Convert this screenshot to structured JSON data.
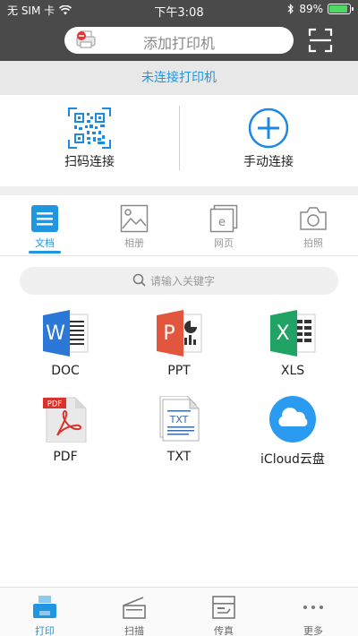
{
  "status_bar": {
    "carrier": "无 SIM 卡",
    "time": "下午3:08",
    "battery_percent": "89%",
    "battery_level": 0.89
  },
  "top_bar": {
    "add_printer_label": "添加打印机",
    "icons": {
      "printer": "printer-remove-icon",
      "scan": "scan-corners-icon"
    }
  },
  "connection": {
    "status_text": "未连接打印机",
    "qr_label": "扫码连接",
    "manual_label": "手动连接"
  },
  "tabs": [
    {
      "label": "文档",
      "icon": "document-icon",
      "active": true
    },
    {
      "label": "相册",
      "icon": "photo-icon",
      "active": false
    },
    {
      "label": "网页",
      "icon": "webpage-icon",
      "active": false
    },
    {
      "label": "拍照",
      "icon": "camera-icon",
      "active": false
    }
  ],
  "search": {
    "placeholder": "请输入关键字"
  },
  "file_types": [
    {
      "label": "DOC",
      "icon": "word-icon",
      "color": "#2b78d6"
    },
    {
      "label": "PPT",
      "icon": "powerpoint-icon",
      "color": "#e2563d"
    },
    {
      "label": "XLS",
      "icon": "excel-icon",
      "color": "#21a366"
    },
    {
      "label": "PDF",
      "icon": "pdf-icon",
      "color": "#d9342b"
    },
    {
      "label": "TXT",
      "icon": "txt-icon",
      "color": "#3a6ea5"
    },
    {
      "label": "iCloud云盘",
      "icon": "icloud-icon",
      "color": "#2a9bf0"
    }
  ],
  "bottom_nav": [
    {
      "label": "打印",
      "icon": "print-icon",
      "active": true
    },
    {
      "label": "扫描",
      "icon": "scanner-icon",
      "active": false
    },
    {
      "label": "传真",
      "icon": "fax-icon",
      "active": false
    },
    {
      "label": "更多",
      "icon": "more-icon",
      "active": false
    }
  ],
  "colors": {
    "accent": "#2196e0",
    "header": "#4a4a4a",
    "battery": "#4cd964"
  }
}
